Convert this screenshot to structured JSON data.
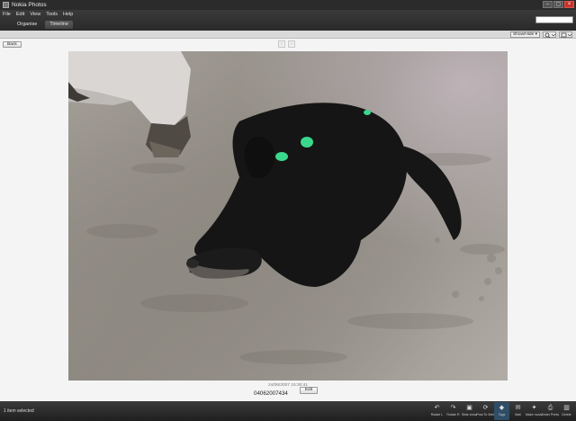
{
  "window": {
    "title": "Nokia Photos",
    "controls": [
      "–",
      "▢",
      "×"
    ]
  },
  "menu": {
    "items": [
      "File",
      "Edit",
      "View",
      "Tools",
      "Help"
    ]
  },
  "search": {
    "placeholder": ""
  },
  "tabs": [
    {
      "label": "Organise",
      "active": false
    },
    {
      "label": "Timeline",
      "active": true
    }
  ],
  "toolbar": {
    "show_hide_label": "Show/Hide ▾",
    "zoom_icon": "magnifier-icon",
    "view_icon": "view-mode-icon"
  },
  "viewer": {
    "back_label": "Back",
    "prev_arrow": "‹",
    "next_arrow": "›",
    "photo_description": "photo-dog-on-sand",
    "date": "24/06/2007 15:30:41",
    "name": "04062007434",
    "edit_label": "Edit"
  },
  "status": {
    "text": "1 item selected"
  },
  "actions": [
    {
      "label": "Rotate L",
      "icon": "rotate-left-icon",
      "glyph": "↶"
    },
    {
      "label": "Rotate R",
      "icon": "rotate-right-icon",
      "glyph": "↷"
    },
    {
      "label": "Slide show",
      "icon": "slideshow-icon",
      "glyph": "▣"
    },
    {
      "label": "Post To Web",
      "icon": "post-web-icon",
      "glyph": "⟳"
    },
    {
      "label": "Tags",
      "icon": "tag-icon",
      "glyph": "◆",
      "active": true
    },
    {
      "label": "Mail",
      "icon": "mail-icon",
      "glyph": "✉"
    },
    {
      "label": "Make movie",
      "icon": "movie-icon",
      "glyph": "✦"
    },
    {
      "label": "Order Prints",
      "icon": "prints-icon",
      "glyph": "⎙"
    },
    {
      "label": "Delete",
      "icon": "delete-icon",
      "glyph": "▥"
    }
  ],
  "colors": {
    "chrome_dark": "#2b2b2b",
    "active_action": "#2f4d66",
    "close_button": "#c8322b",
    "tag_marker": "#3ad88c"
  }
}
